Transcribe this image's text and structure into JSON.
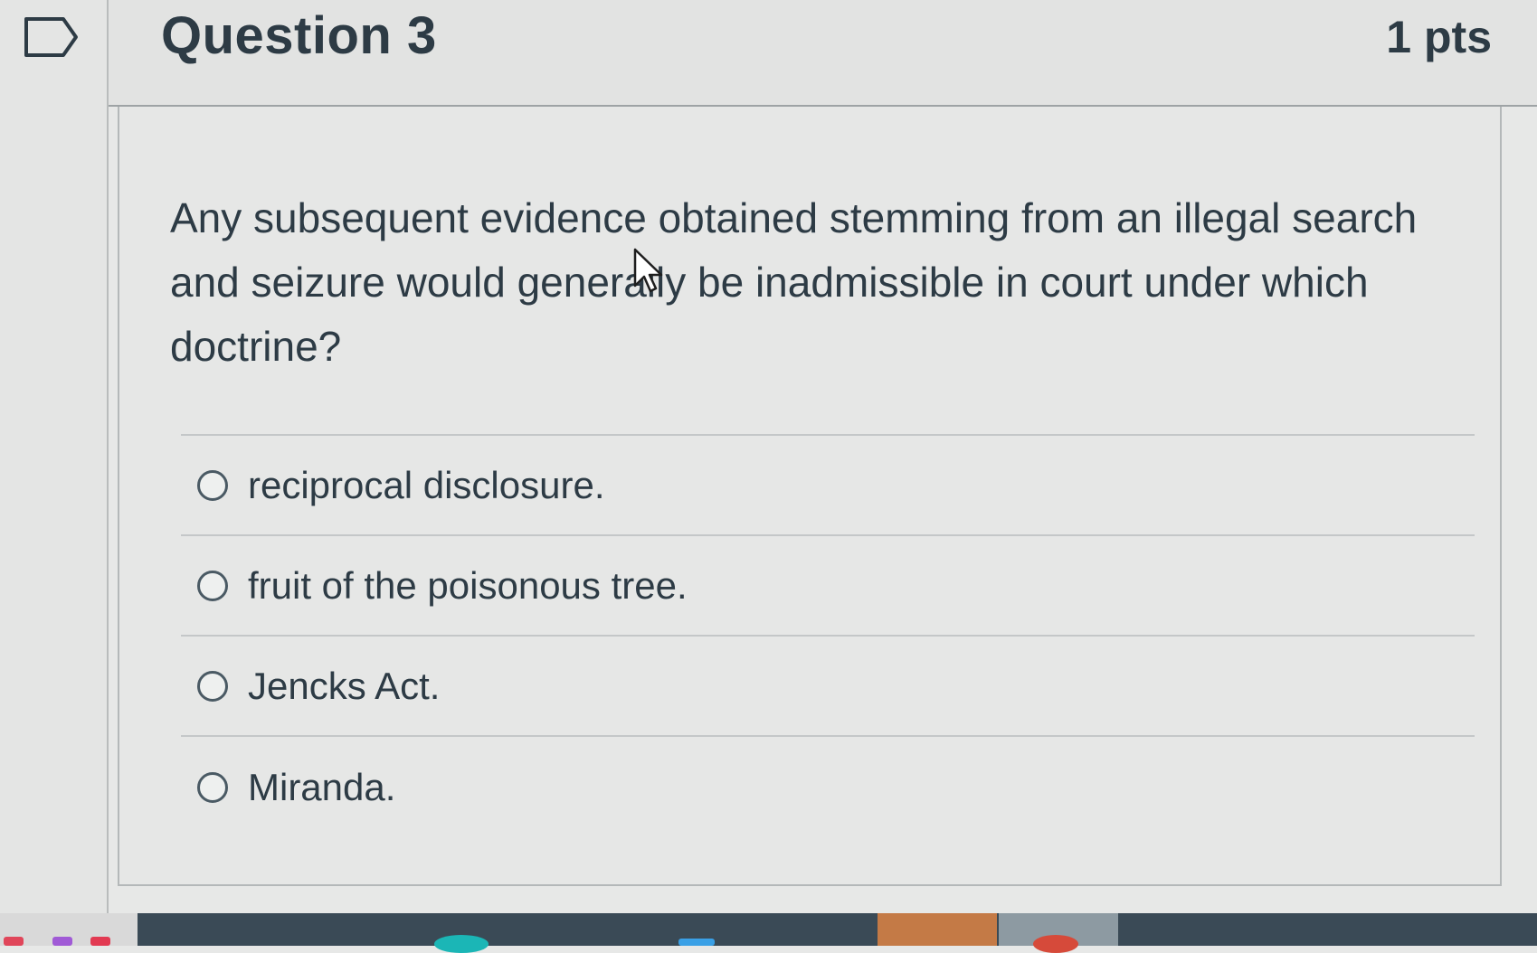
{
  "question": {
    "title": "Question 3",
    "points": "1 pts",
    "text": "Any subsequent evidence obtained stemming from an illegal search and seizure would generally be inadmissible in court under which doctrine?",
    "answers": [
      {
        "label": "reciprocal disclosure.",
        "selected": false
      },
      {
        "label": "fruit of the poisonous tree.",
        "selected": false
      },
      {
        "label": "Jencks Act.",
        "selected": false
      },
      {
        "label": "Miranda.",
        "selected": false
      }
    ]
  },
  "icons": {
    "flag": "flag-question-icon",
    "cursor": "mouse-pointer-icon",
    "radio": "radio-unselected-icon"
  },
  "colors": {
    "text": "#2d3b45",
    "background": "#e7e8e7",
    "divider": "#c4c7c8",
    "taskbar": "#3a4a56"
  }
}
